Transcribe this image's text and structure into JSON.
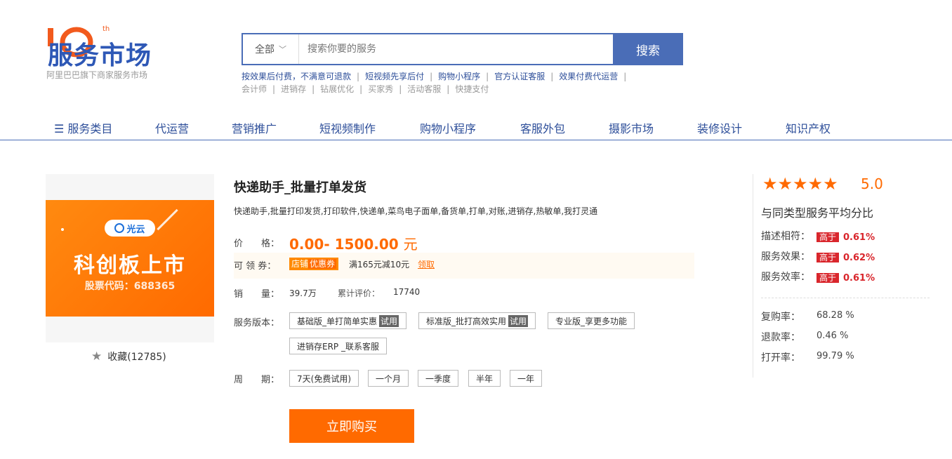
{
  "header": {
    "logo_text": "服务市场",
    "logo_superscript": "th",
    "logo_sub": "阿里巴巴旗下商家服务市场",
    "search": {
      "category": "全部",
      "placeholder": "搜索你要的服务",
      "button": "搜索"
    },
    "hot_links_row1": [
      "按效果后付费，不满意可退款",
      "短视频先享后付",
      "购物小程序",
      "官方认证客服",
      "效果付费代运营"
    ],
    "hot_links_row2": [
      "会计师",
      "进销存",
      "钻展优化",
      "买家秀",
      "活动客服",
      "快捷支付"
    ]
  },
  "nav": {
    "items": [
      "☰ 服务类目",
      "代运营",
      "营销推广",
      "短视频制作",
      "购物小程序",
      "客服外包",
      "摄影市场",
      "装修设计",
      "知识产权"
    ]
  },
  "product": {
    "image": {
      "badge": "光云",
      "big_text": "科创板上市",
      "small_text": "股票代码：688365"
    },
    "favorite": "收藏(12785)",
    "title": "快递助手_批量打单发货",
    "description": "快递助手,批量打印发货,打印软件,快递单,菜鸟电子面单,备货单,打单,对账,进销存,热敏单,我打灵通",
    "price_label": "价　　格：",
    "price": "0.00- 1500.00",
    "price_unit": "元",
    "coupon_label": "可 领 券：",
    "coupon_tag_a": "店铺",
    "coupon_tag_b": "优惠券",
    "coupon_text": "满165元减10元",
    "coupon_get": "领取",
    "sales_label": "销　　量：",
    "sales": "39.7万",
    "reviews_label": "累计评价：",
    "reviews": "17740",
    "version_label": "服务版本：",
    "versions": [
      {
        "name": "基础版_单打简单实惠",
        "trial": "试用"
      },
      {
        "name": "标准版_批打高效实用",
        "trial": "试用"
      },
      {
        "name": "专业版_享更多功能",
        "trial": ""
      },
      {
        "name": "进销存ERP _联系客服",
        "trial": ""
      }
    ],
    "period_label": "周　　期：",
    "periods": [
      "7天(免费试用)",
      "一个月",
      "一季度",
      "半年",
      "一年"
    ],
    "buy_button": "立即购买"
  },
  "rating": {
    "stars": 5,
    "score": "5.0",
    "compare_title": "与同类型服务平均分比",
    "metrics": [
      {
        "label": "描述相符：",
        "tag": "高于",
        "value": "0.61%"
      },
      {
        "label": "服务效果：",
        "tag": "高于",
        "value": "0.62%"
      },
      {
        "label": "服务效率：",
        "tag": "高于",
        "value": "0.61%"
      }
    ],
    "stats": [
      {
        "label": "复购率：",
        "value": "68.28 %"
      },
      {
        "label": "退款率：",
        "value": "0.46 %"
      },
      {
        "label": "打开率：",
        "value": "99.79 %"
      }
    ]
  },
  "colors": {
    "brand_blue": "#4a6db7",
    "accent_orange": "#ff6a00",
    "tag_red": "#d9262c"
  }
}
